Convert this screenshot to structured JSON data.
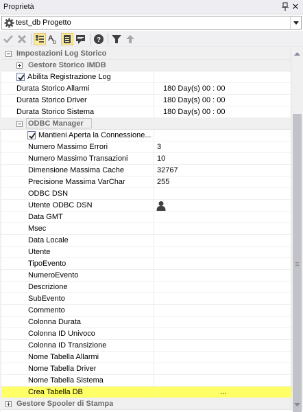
{
  "window": {
    "title": "Proprietà"
  },
  "object_selector": {
    "value": "test_db Progetto"
  },
  "toolbar": {
    "buttons": [
      "check-icon",
      "cancel-icon",
      "categorized-icon",
      "alphabetical-icon",
      "property-pages-icon",
      "comments-icon",
      "help-icon",
      "filter-icon",
      "up-arrow-icon"
    ]
  },
  "properties": {
    "rows": [
      {
        "name": "Impostazioni Log Storico",
        "value": ""
      },
      {
        "name": "Gestore Storico IMDB",
        "value": ""
      },
      {
        "name": "Abilita Registrazione Log",
        "value": ""
      },
      {
        "name": "Durata Storico Allarmi",
        "value": "180 Day(s)  00 : 00"
      },
      {
        "name": "Durata Storico Driver",
        "value": "180 Day(s)  00 : 00"
      },
      {
        "name": "Durata Storico Sistema",
        "value": "180 Day(s)  00 : 00"
      },
      {
        "name": "ODBC Manager",
        "value": ""
      },
      {
        "name": "Mantieni Aperta la Connessione...",
        "value": ""
      },
      {
        "name": "Numero Massimo Errori",
        "value": "3"
      },
      {
        "name": "Numero Massimo Transazioni",
        "value": "10"
      },
      {
        "name": "Dimensione Massima Cache",
        "value": "32767"
      },
      {
        "name": "Precisione Massima VarChar",
        "value": "255"
      },
      {
        "name": "ODBC DSN",
        "value": ""
      },
      {
        "name": "Utente ODBC DSN",
        "value": ""
      },
      {
        "name": "Data GMT",
        "value": ""
      },
      {
        "name": "Msec",
        "value": ""
      },
      {
        "name": "Data Locale",
        "value": ""
      },
      {
        "name": "Utente",
        "value": ""
      },
      {
        "name": "TipoEvento",
        "value": ""
      },
      {
        "name": "NumeroEvento",
        "value": ""
      },
      {
        "name": "Descrizione",
        "value": ""
      },
      {
        "name": "SubEvento",
        "value": ""
      },
      {
        "name": "Commento",
        "value": ""
      },
      {
        "name": "Colonna Durata",
        "value": ""
      },
      {
        "name": "Colonna ID Univoco",
        "value": ""
      },
      {
        "name": "Colonna ID Transizione",
        "value": ""
      },
      {
        "name": "Nome Tabella Allarmi",
        "value": ""
      },
      {
        "name": "Nome Tabella Driver",
        "value": ""
      },
      {
        "name": "Nome Tabella Sistema",
        "value": ""
      },
      {
        "name": "Crea Tabella DB",
        "value": "..."
      },
      {
        "name": "Gestore Spooler di Stampa",
        "value": ""
      }
    ]
  },
  "colors": {
    "highlight": "#ffff66",
    "category_bg": "#f0f0f0"
  }
}
